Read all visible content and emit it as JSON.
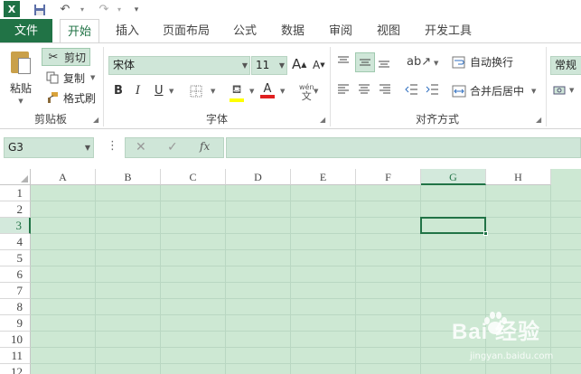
{
  "quick_access": {
    "app_logo": "X",
    "icons": [
      "excel-logo",
      "save-icon",
      "undo-icon",
      "redo-icon",
      "customize-qat-icon"
    ]
  },
  "tabs": [
    {
      "label": "文件"
    },
    {
      "label": "开始"
    },
    {
      "label": "插入"
    },
    {
      "label": "页面布局"
    },
    {
      "label": "公式"
    },
    {
      "label": "数据"
    },
    {
      "label": "审阅"
    },
    {
      "label": "视图"
    },
    {
      "label": "开发工具"
    }
  ],
  "clipboard": {
    "group_label": "剪贴板",
    "paste": "粘贴",
    "cut": "剪切",
    "copy": "复制",
    "format_painter": "格式刷"
  },
  "font": {
    "group_label": "字体",
    "font_name": "宋体",
    "font_size": "11",
    "grow": "A",
    "shrink": "A",
    "bold": "B",
    "italic": "I",
    "underline": "U",
    "phonetic_top": "wén",
    "phonetic_bottom": "文",
    "font_color": "A"
  },
  "alignment": {
    "group_label": "对齐方式",
    "wrap_text": "自动换行",
    "merge_center": "合并后居中"
  },
  "number": {
    "format": "常规"
  },
  "formula_bar": {
    "name_box": "G3",
    "fx": "fx",
    "cancel": "✕",
    "enter": "✓",
    "formula": ""
  },
  "sheet": {
    "columns": [
      "A",
      "B",
      "C",
      "D",
      "E",
      "F",
      "G",
      "H"
    ],
    "rows": [
      "1",
      "2",
      "3",
      "4",
      "5",
      "6",
      "7",
      "8",
      "9",
      "10",
      "11",
      "12"
    ],
    "active_cell": "G3",
    "selected_column": "G",
    "selected_row": "3"
  },
  "watermark": {
    "logo": "Bai  经验",
    "url": "jingyan.baidu.com"
  },
  "colors": {
    "excel_green": "#217346",
    "sheet_bg": "#cde8d3",
    "highlight_yellow": "#ffff00",
    "font_red": "#e02020"
  }
}
